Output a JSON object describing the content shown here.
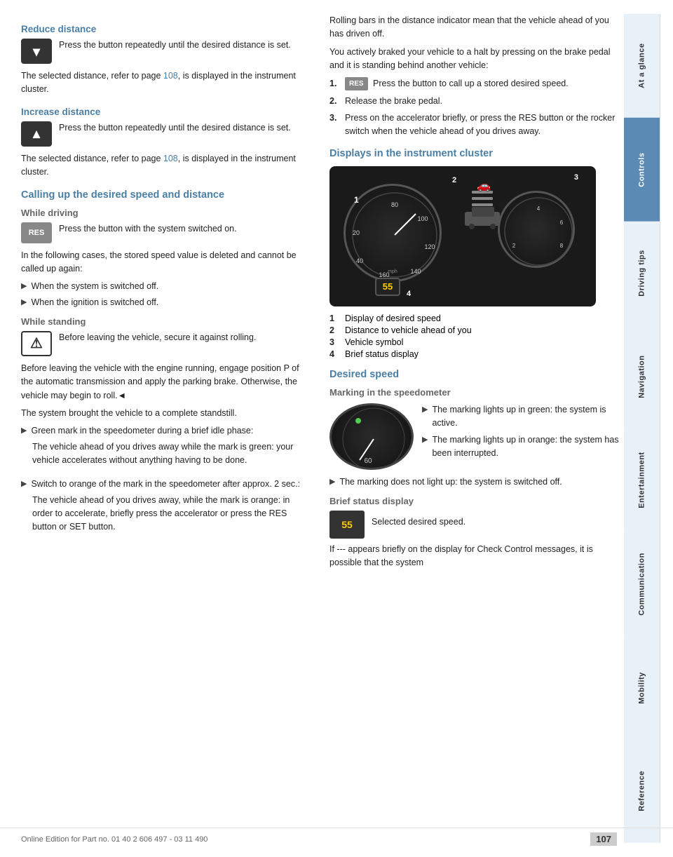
{
  "sidebar": {
    "tabs": [
      {
        "label": "At a glance",
        "active": false
      },
      {
        "label": "Controls",
        "active": true
      },
      {
        "label": "Driving tips",
        "active": false
      },
      {
        "label": "Navigation",
        "active": false
      },
      {
        "label": "Entertainment",
        "active": false
      },
      {
        "label": "Communication",
        "active": false
      },
      {
        "label": "Mobility",
        "active": false
      },
      {
        "label": "Reference",
        "active": false
      }
    ]
  },
  "page": {
    "number": "107",
    "footer_text": "Online Edition for Part no. 01 40 2 606 497 - 03 11 490"
  },
  "left_col": {
    "reduce_distance": {
      "heading": "Reduce distance",
      "icon_label": "down-arrow-icon",
      "description": "Press the button repeatedly until the desired distance is set.",
      "note": "The selected distance, refer to page ",
      "note_link": "108",
      "note_end": ", is displayed in the instrument cluster."
    },
    "increase_distance": {
      "heading": "Increase distance",
      "icon_label": "up-arrow-icon",
      "description": "Press the button repeatedly until the desired distance is set.",
      "note": "The selected distance, refer to page ",
      "note_link": "108",
      "note_end": ", is displayed in the instrument cluster."
    },
    "calling_up": {
      "heading": "Calling up the desired speed and distance",
      "while_driving": {
        "sub_heading": "While driving",
        "icon_label": "res-button-icon",
        "description": "Press the button with the system switched on.",
        "note": "In the following cases, the stored speed value is deleted and cannot be called up again:",
        "bullets": [
          "When the system is switched off.",
          "When the ignition is switched off."
        ]
      },
      "while_standing": {
        "sub_heading": "While standing",
        "icon_label": "warning-icon",
        "description": "Before leaving the vehicle, secure it against rolling.",
        "body1": "Before leaving the vehicle with the engine running, engage position P of the automatic transmission and apply the parking brake. Otherwise, the vehicle may begin to roll.◄",
        "body2": "The system brought the vehicle to a complete standstill.",
        "bullets": [
          {
            "main": "Green mark in the speedometer during a brief idle phase:",
            "sub": "The vehicle ahead of you drives away while the mark is green: your vehicle accelerates without anything having to be done."
          },
          {
            "main": "Switch to orange of the mark in the speedometer after approx. 2 sec.:",
            "sub": "The vehicle ahead of you drives away, while the mark is orange: in order to accelerate, briefly press the accelerator or press the RES button or SET button."
          }
        ]
      }
    }
  },
  "right_col": {
    "rolling_bars_text": "Rolling bars in the distance indicator mean that the vehicle ahead of you has driven off.",
    "braked_text": "You actively braked your vehicle to a halt by pressing on the brake pedal and it is standing behind another vehicle:",
    "numbered_steps": [
      {
        "num": "1.",
        "text": "Press the button to call up a stored desired speed.",
        "has_icon": true
      },
      {
        "num": "2.",
        "text": "Release the brake pedal."
      },
      {
        "num": "3.",
        "text": "Press on the accelerator briefly, or press the RES button or the rocker switch when the vehicle ahead of you drives away."
      }
    ],
    "displays_heading": "Displays in the instrument cluster",
    "cluster_labels": [
      {
        "num": "1",
        "text": "Display of desired speed"
      },
      {
        "num": "2",
        "text": "Distance to vehicle ahead of you"
      },
      {
        "num": "3",
        "text": "Vehicle symbol"
      },
      {
        "num": "4",
        "text": "Brief status display"
      }
    ],
    "desired_speed": {
      "heading": "Desired speed",
      "marking_sub_heading": "Marking in the speedometer",
      "marking_bullets": [
        "The marking lights up in green: the system is active.",
        "The marking lights up in orange: the system has been interrupted."
      ],
      "no_light_text": "The marking does not light up: the system is switched off.",
      "brief_status": {
        "sub_heading": "Brief status display",
        "icon_value": "55",
        "description": "Selected desired speed."
      },
      "final_text": "If --- appears briefly on the display for Check Control messages, it is possible that the system"
    }
  }
}
